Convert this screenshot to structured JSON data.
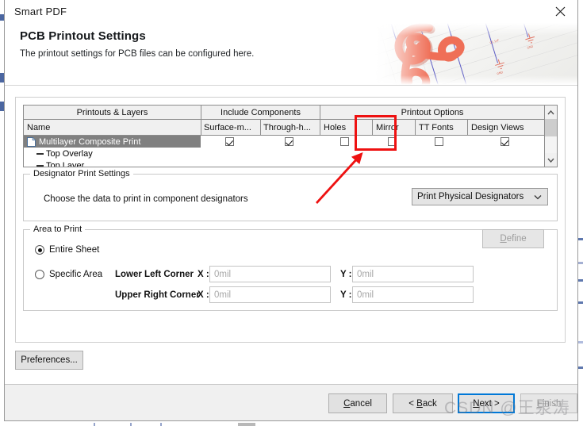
{
  "window": {
    "title": "Smart PDF",
    "close_icon": "close-icon"
  },
  "banner": {
    "heading": "PCB Printout Settings",
    "subheading": "The printout settings for PCB files can be configured here.",
    "art_name": "acrobat-pdf-schematic-graphic"
  },
  "grid": {
    "group_headers": [
      {
        "label": "Printouts & Layers"
      },
      {
        "label": "Include Components"
      },
      {
        "label": "Printout Options"
      }
    ],
    "columns": [
      {
        "label": "Name"
      },
      {
        "label": "Surface-m..."
      },
      {
        "label": "Through-h..."
      },
      {
        "label": "Holes"
      },
      {
        "label": "Mirror"
      },
      {
        "label": "TT Fonts"
      },
      {
        "label": "Design Views"
      }
    ],
    "rows": [
      {
        "name": "Multilayer Composite Print",
        "kind": "print",
        "selected": true,
        "checks": [
          true,
          true,
          false,
          false,
          false,
          true
        ]
      },
      {
        "name": "Top Overlay",
        "kind": "layer",
        "selected": false,
        "checks": []
      },
      {
        "name": "Top Layer",
        "kind": "layer",
        "selected": false,
        "checks": []
      }
    ],
    "scrollbar": {
      "up_icon": "chevron-up-icon",
      "down_icon": "chevron-down-icon"
    }
  },
  "designator_settings": {
    "legend": "Designator Print Settings",
    "label": "Choose the data to print in component designators",
    "dropdown_value": "Print Physical Designators",
    "dropdown_icon": "chevron-down-icon"
  },
  "area_to_print": {
    "legend": "Area to Print",
    "options": [
      {
        "label": "Entire Sheet",
        "selected": true
      },
      {
        "label": "Specific Area",
        "selected": false
      }
    ],
    "rows": [
      {
        "label": "Lower Left Corner",
        "x_label": "X :",
        "x_value": "0mil",
        "y_label": "Y :",
        "y_value": "0mil"
      },
      {
        "label": "Upper Right Corner",
        "x_label": "X :",
        "x_value": "0mil",
        "y_label": "Y :",
        "y_value": "0mil"
      }
    ],
    "define_button": "Define",
    "define_button_enabled": false
  },
  "preferences_button": "Preferences...",
  "footer": {
    "cancel": "Cancel",
    "back": "< Back",
    "next": "Next >",
    "finish": "Finish"
  },
  "annotations": {
    "highlight_target": "mirror-checkbox",
    "color": "#ee1111"
  },
  "watermark": {
    "text": "CSDN @王泉涛"
  }
}
